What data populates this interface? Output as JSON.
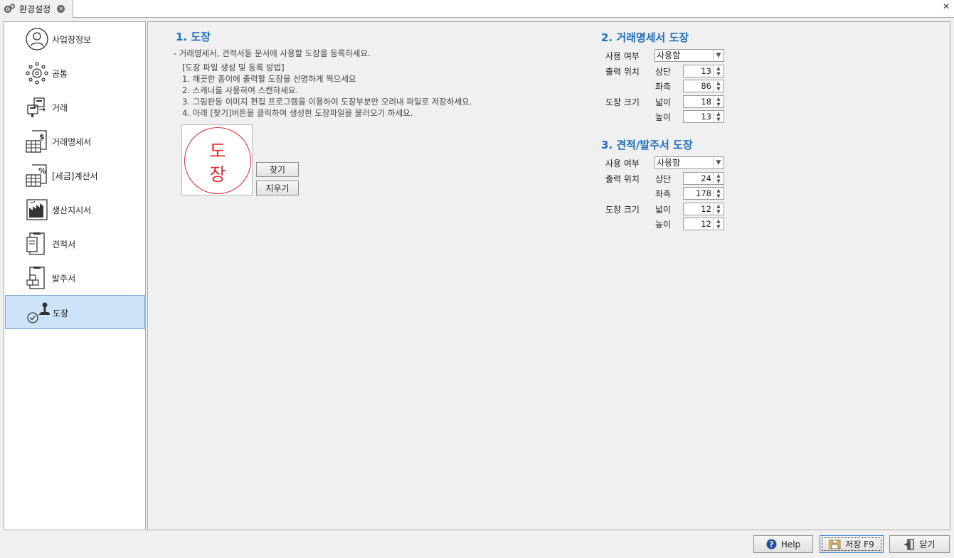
{
  "tab": {
    "title": "환경설정",
    "close": "✕"
  },
  "window": {
    "close": "✕"
  },
  "sidebar": {
    "items": [
      {
        "label": "사업장정보",
        "icon": "person-icon"
      },
      {
        "label": "공통",
        "icon": "gear-icon"
      },
      {
        "label": "거래",
        "icon": "transaction-icon"
      },
      {
        "label": "거래명세서",
        "icon": "statement-icon"
      },
      {
        "label": "[세금]계산서",
        "icon": "tax-invoice-icon"
      },
      {
        "label": "생산지시서",
        "icon": "factory-icon"
      },
      {
        "label": "견적서",
        "icon": "estimate-icon"
      },
      {
        "label": "발주서",
        "icon": "order-icon"
      },
      {
        "label": "도장",
        "icon": "stamp-icon"
      }
    ],
    "active_index": 8
  },
  "section1": {
    "title": "1. 도장",
    "intro": "- 거래명세서, 견적서등 문서에 사용할 도장을 등록하세요.",
    "steps_title": "[도장 파일 생성 및 등록 방법]",
    "steps": [
      "1. 깨끗한 종이에 출력할 도장을 선명하게 찍으세요",
      "2. 스캐너를 사용하여 스캔하세요.",
      "3. 그림판등 이미지 편집 프로그램을 이용하여 도장부분만 오려내 파일로 저장하세요.",
      "4. 아래 [찾기]버튼을 클릭하여 생성한 도장파일을 불러오기 하세요."
    ],
    "stamp_top": "도",
    "stamp_bottom": "장",
    "find_button": "찾기",
    "clear_button": "지우기"
  },
  "section2": {
    "title": "2. 거래명세서 도장",
    "use_label": "사용 여부",
    "use_value": "사용함",
    "position_label": "출력 위치",
    "top_label": "상단",
    "top_value": "13",
    "left_label": "좌측",
    "left_value": "86",
    "size_label": "도장 크기",
    "width_label": "넓이",
    "width_value": "18",
    "height_label": "높이",
    "height_value": "13"
  },
  "section3": {
    "title": "3. 견적/발주서 도장",
    "use_label": "사용 여부",
    "use_value": "사용함",
    "position_label": "출력 위치",
    "top_label": "상단",
    "top_value": "24",
    "left_label": "좌측",
    "left_value": "178",
    "size_label": "도장 크기",
    "width_label": "넓이",
    "width_value": "12",
    "height_label": "높이",
    "height_value": "12"
  },
  "footer": {
    "help_label": "Help",
    "save_label": "저장 F9",
    "close_label": "닫기"
  }
}
